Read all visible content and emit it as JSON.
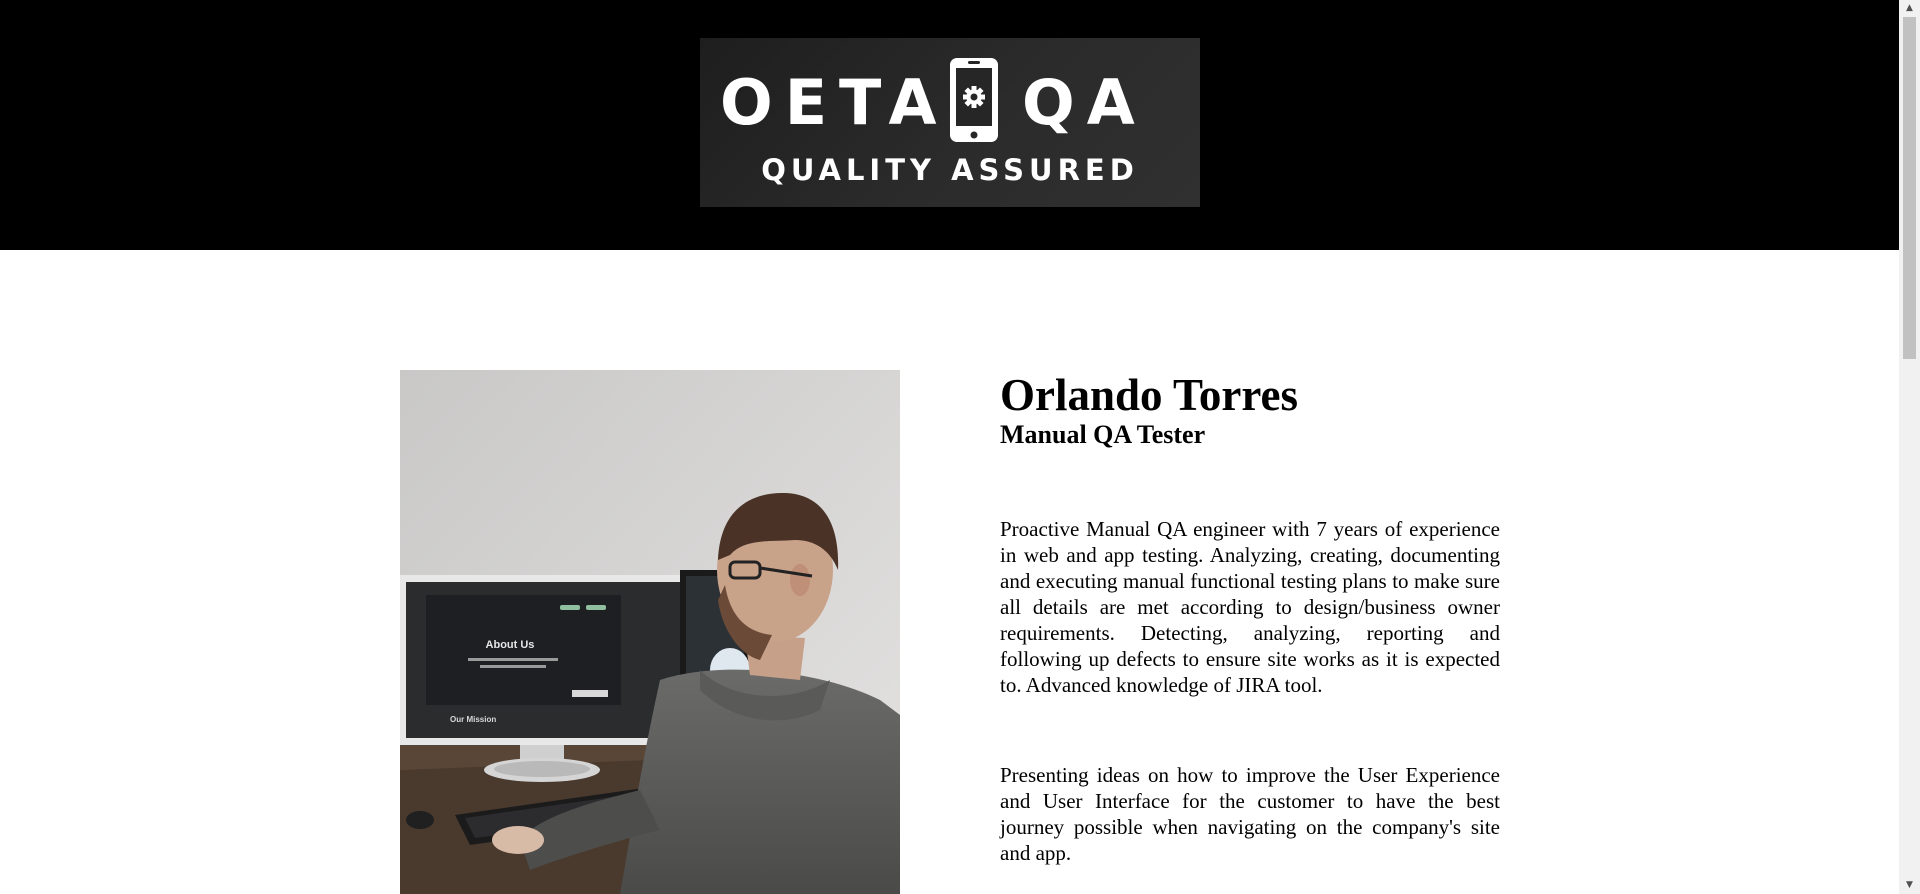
{
  "logo": {
    "left_word": "OETA",
    "right_word": "QA",
    "tagline": "QUALITY ASSURED",
    "icon": "phone-gear-icon"
  },
  "photo": {
    "icon": "photo-man-at-computer",
    "screen_heading": "About Us",
    "screen_subheading": "Our Mission"
  },
  "profile": {
    "name": "Orlando Torres",
    "role": "Manual QA Tester",
    "summary": "Proactive Manual QA engineer with 7 years of experience in web and app testing. Analyzing, creating, documenting and executing manual functional testing plans to make sure all details are met according to design/business owner requirements. Detecting, analyzing, reporting and following up defects to ensure site works as it is expected to. Advanced knowledge of JIRA tool.",
    "ux_statement": "Presenting ideas on how to improve the User Experience and User Interface for the customer to have the best journey possible when navigating on the company's site and app."
  },
  "scrollbar": {
    "up_arrow": "▲",
    "down_arrow": "▼",
    "scroll_position_fraction": 0.0
  },
  "colors": {
    "header_bg": "#000000",
    "page_bg": "#ffffff",
    "text": "#000000"
  }
}
